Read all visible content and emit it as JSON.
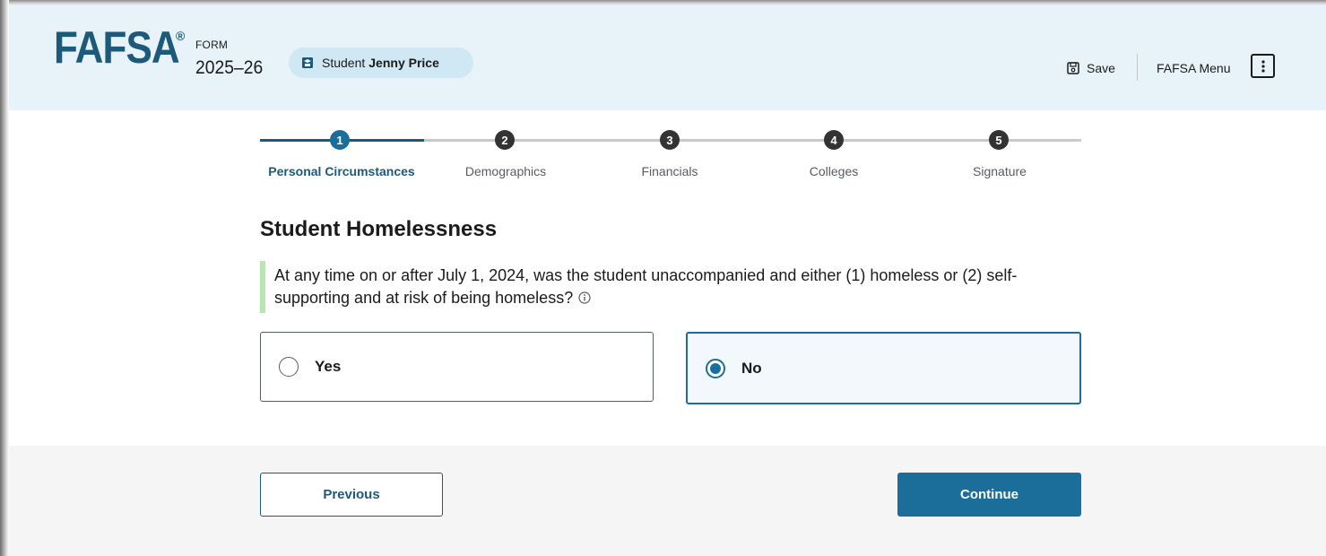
{
  "header": {
    "logo_text": "FAFSA",
    "logo_mark": "®",
    "form_label": "FORM",
    "form_year": "2025–26",
    "student_prefix": "Student",
    "student_name": "Jenny Price",
    "student_icon": "student-cap-icon",
    "save_label": "Save",
    "save_icon": "save-icon",
    "menu_label": "FAFSA Menu",
    "menu_icon": "kebab-menu-icon"
  },
  "stepper": {
    "steps": [
      {
        "number": "1",
        "label": "Personal Circumstances",
        "active": true
      },
      {
        "number": "2",
        "label": "Demographics",
        "active": false
      },
      {
        "number": "3",
        "label": "Financials",
        "active": false
      },
      {
        "number": "4",
        "label": "Colleges",
        "active": false
      },
      {
        "number": "5",
        "label": "Signature",
        "active": false
      }
    ]
  },
  "main": {
    "heading": "Student Homelessness",
    "question": "At any time on or after July 1, 2024, was the student unaccompanied and either (1) homeless or (2) self-supporting and at risk of being homeless?",
    "info_icon": "info-circle-icon",
    "options": [
      {
        "label": "Yes",
        "selected": false
      },
      {
        "label": "No",
        "selected": true
      }
    ]
  },
  "footer": {
    "previous_label": "Previous",
    "continue_label": "Continue"
  },
  "colors": {
    "brand_blue": "#1b5a7b",
    "accent_blue": "#1b6e99",
    "header_bg": "#e7f2f9",
    "question_bar": "#b8e6b1"
  }
}
